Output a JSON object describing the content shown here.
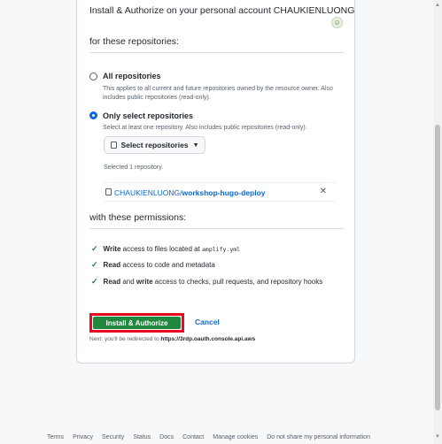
{
  "header": {
    "text": "Install & Authorize on your personal account CHAUKIENLUONG"
  },
  "repos_section": {
    "title": "for these repositories:"
  },
  "options": [
    {
      "label": "All repositories",
      "desc": "This applies to all current and future repositories owned by the resource owner. Also includes public repositories (read-only).",
      "selected": false
    },
    {
      "label": "Only select repositories",
      "desc": "Select at least one repository. Also includes public repositories (read-only).",
      "selected": true
    }
  ],
  "select_button": {
    "label": "Select repositories",
    "icon": "repo-icon"
  },
  "selected_count": "Selected 1 repository.",
  "repo": {
    "owner": "CHAUKIENLUONG",
    "name": "workshop-hugo-deploy"
  },
  "permissions_section": {
    "title": "with these permissions:"
  },
  "permissions": [
    {
      "bold": "Write",
      "text": " access to files located at ",
      "code": "amplify.yml"
    },
    {
      "bold": "Read",
      "text": " access to code and metadata",
      "code": ""
    },
    {
      "bold": "Read",
      "text": " and ",
      "bold2": "write",
      "text2": " access to checks, pull requests, and repository hooks"
    }
  ],
  "actions": {
    "install": "Install & Authorize",
    "cancel": "Cancel"
  },
  "redirect": {
    "prefix": "Next: you'll be redirected to ",
    "url": "https://3rdp.oauth.console.api.aws"
  },
  "footer": [
    "Terms",
    "Privacy",
    "Security",
    "Status",
    "Docs",
    "Contact",
    "Manage cookies",
    "Do not share my personal information"
  ],
  "colors": {
    "primary_button": "#1f883d",
    "link": "#0969da",
    "highlight_border": "#e8081f",
    "check": "#1a7f37"
  }
}
